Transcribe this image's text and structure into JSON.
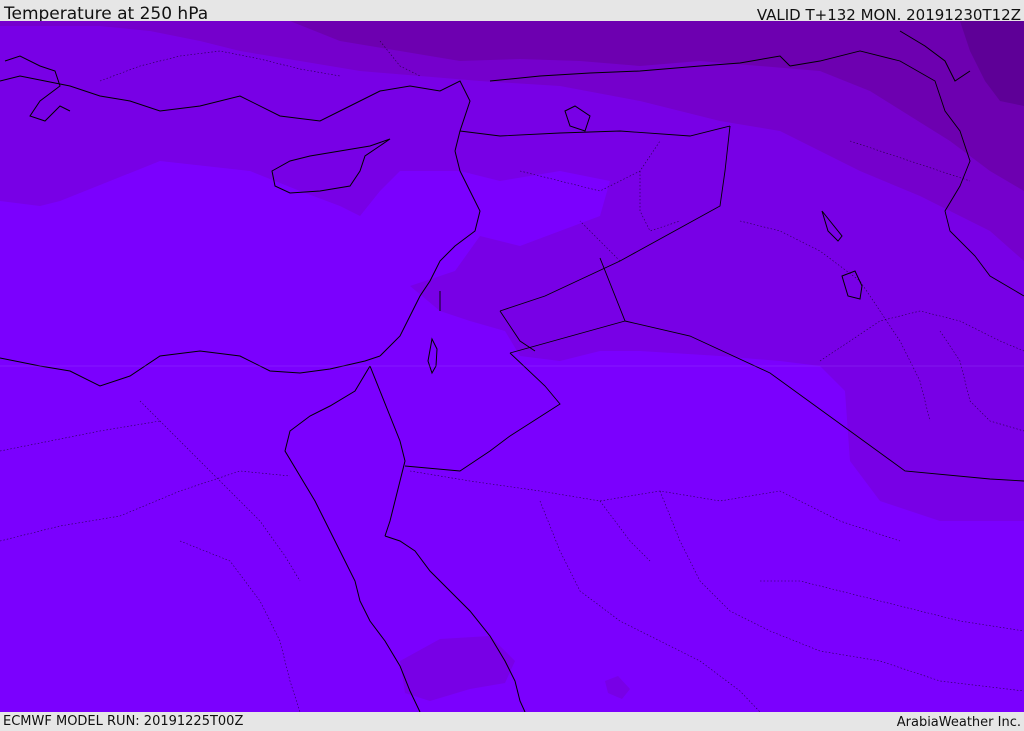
{
  "header": {
    "title": "Temperature at 250 hPa",
    "valid_time": "VALID T+132 MON. 20191230T12Z"
  },
  "footer": {
    "model_run": "ECMWF MODEL RUN: 20191225T00Z",
    "credit": "ArabiaWeather Inc."
  },
  "palette": {
    "base": "#7b00fe",
    "band_1": "#7800e6",
    "band_2": "#7500cc",
    "band_3": "#6d00b0",
    "band_4": "#5e0097",
    "outline": "#000000"
  }
}
